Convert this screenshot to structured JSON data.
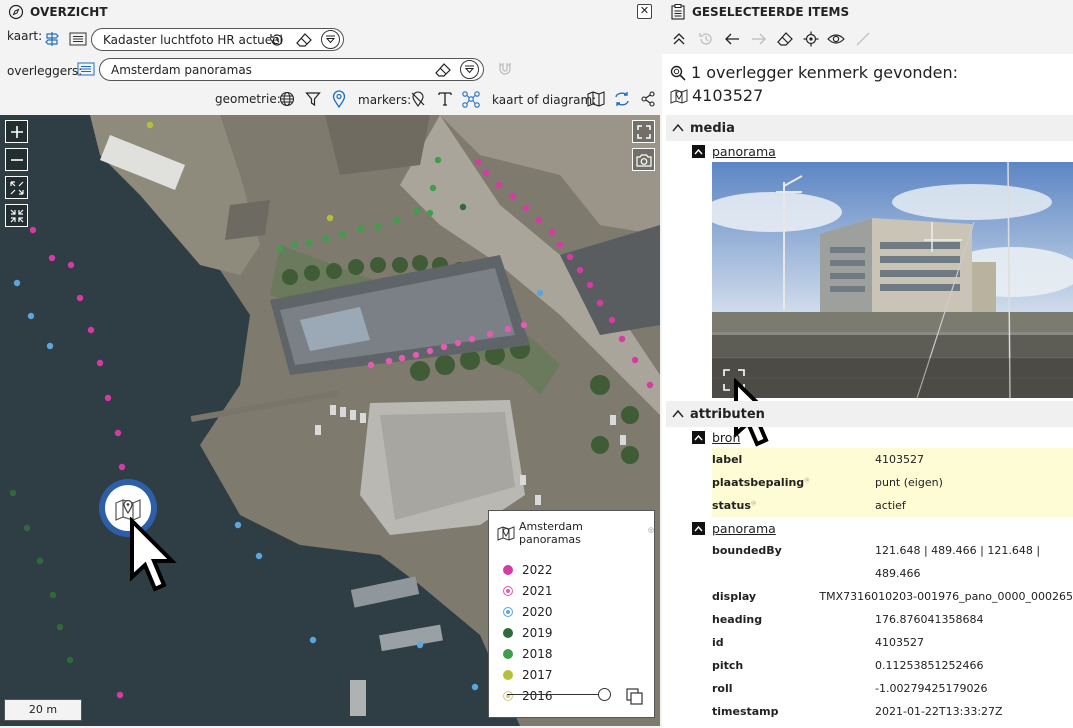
{
  "left": {
    "title": "OVERZICHT",
    "close_icon": "close-icon",
    "kaart": {
      "label": "kaart:",
      "value": "Kadaster luchtfoto HR actueel"
    },
    "overleggers": {
      "label": "overleggers:",
      "value": "Amsterdam panoramas"
    },
    "toolbar": {
      "geometrie": "geometrie:",
      "markers": "markers:",
      "kaart_of_diagram": "kaart of diagram:"
    },
    "scale": "20 m",
    "legend": {
      "title": "Amsterdam panoramas",
      "items": [
        {
          "year": "2022",
          "color": "#d63ba4"
        },
        {
          "year": "2021",
          "color": "#e35bb3"
        },
        {
          "year": "2020",
          "color": "#5aa7e0"
        },
        {
          "year": "2019",
          "color": "#2f6b3a"
        },
        {
          "year": "2018",
          "color": "#3f9e4a"
        },
        {
          "year": "2017",
          "color": "#b3c13a"
        },
        {
          "year": "2016",
          "color": "#d8c98a"
        }
      ]
    }
  },
  "right": {
    "title": "GESELECTEERDE ITEMS",
    "found_text": "1 overlegger kenmerk gevonden:",
    "feature_id": "4103527",
    "media_section": "media",
    "media_link": "panorama",
    "attributes_section": "attributen",
    "bron_link": "bron",
    "bron_props": [
      {
        "key": "label",
        "value": "4103527"
      },
      {
        "key": "plaatsbepaling",
        "value": "punt (eigen)"
      },
      {
        "key": "status",
        "value": "actief"
      }
    ],
    "pano_link": "panorama",
    "pano_props": [
      {
        "key": "boundedBy",
        "value": "121.648 | 489.466 | 121.648 |",
        "value2": "489.466"
      },
      {
        "key": "display",
        "value": "TMX7316010203-001976_pano_0000_000265"
      },
      {
        "key": "heading",
        "value": "176.876041358684"
      },
      {
        "key": "id",
        "value": "4103527"
      },
      {
        "key": "pitch",
        "value": "0.11253851252466"
      },
      {
        "key": "roll",
        "value": "-1.00279425179026"
      },
      {
        "key": "timestamp",
        "value": "2021-01-22T13:33:27Z"
      }
    ]
  }
}
